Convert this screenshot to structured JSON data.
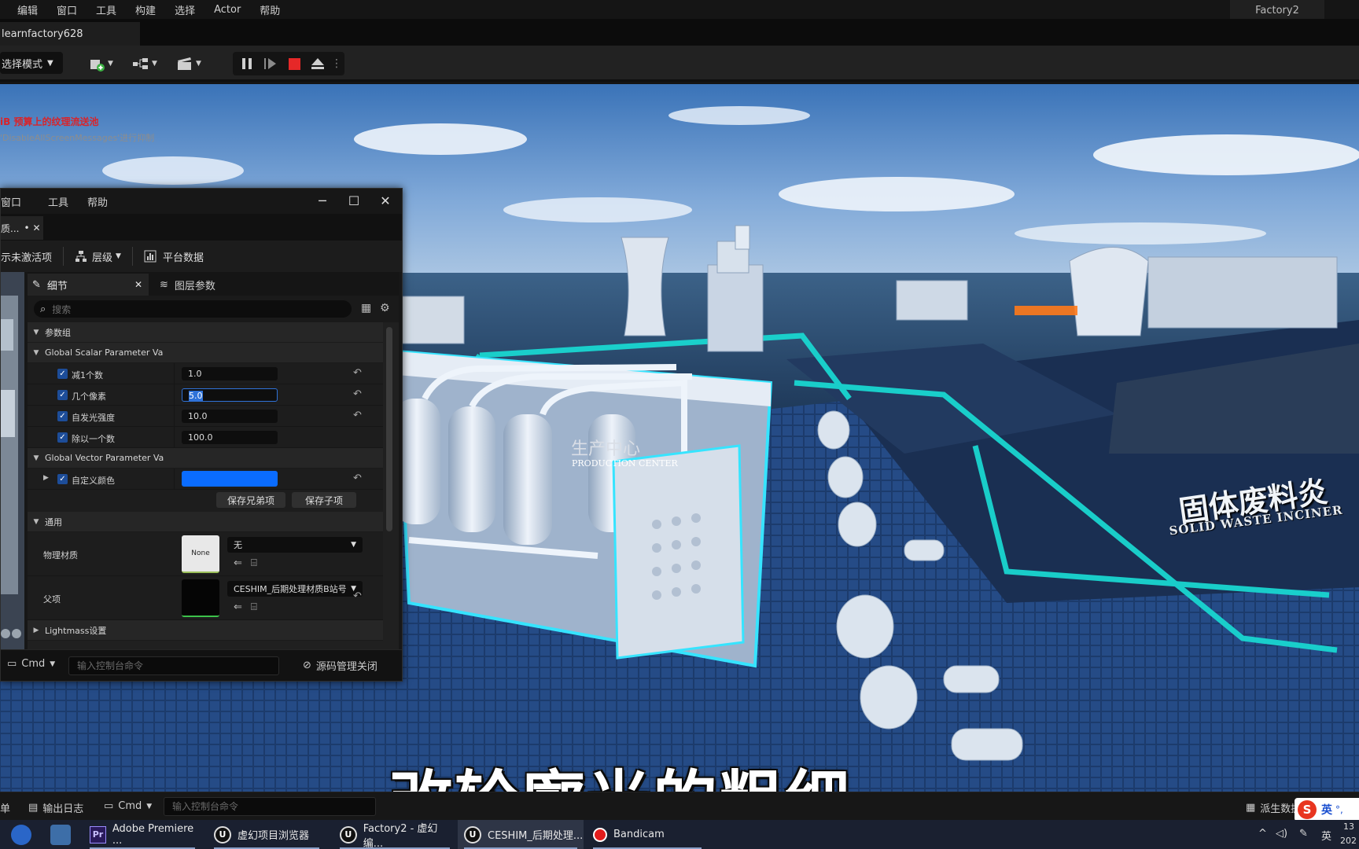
{
  "menu": {
    "items": [
      "编辑",
      "窗口",
      "工具",
      "构建",
      "选择",
      "Actor",
      "帮助"
    ],
    "project_title": "Factory2"
  },
  "level_tab": {
    "label": "learnfactory628"
  },
  "toolbar": {
    "mode_label": "选择模式"
  },
  "viewport": {
    "warning_red": "iB 预算上的纹理流送池",
    "warning_gray": "'DisableAllScreenMessages'进行抑制",
    "sign_solid_waste_zh": "固体废料炎",
    "sign_solid_waste_en": "SOLID WASTE INCINER",
    "sign_production_zh": "生产中心",
    "sign_production_en": "PRODUCTION CENTER",
    "subtitle": "改轮廓光的粗细"
  },
  "panel": {
    "menu": [
      "窗口",
      "工具",
      "帮助"
    ],
    "doc_tab": "质...",
    "toolbar": {
      "inactive_label": "示未激活项",
      "hierarchy_label": "层级",
      "platform_label": "平台数据"
    },
    "details_tab": "细节",
    "layer_tab": "图层参数",
    "search_placeholder": "搜索",
    "categories": {
      "param_group": "参数组",
      "scalar": "Global Scalar Parameter Va",
      "vector": "Global Vector Parameter Va",
      "general": "通用",
      "lightmass": "Lightmass设置"
    },
    "scalar_params": [
      {
        "label": "减1个数",
        "value": "1.0"
      },
      {
        "label": "几个像素",
        "value": "5.0"
      },
      {
        "label": "自发光强度",
        "value": "10.0"
      },
      {
        "label": "除以一个数",
        "value": "100.0"
      }
    ],
    "vector_param": {
      "label": "自定义颜色",
      "color": "#0a6cff"
    },
    "buttons": {
      "save_sibling": "保存兄弟项",
      "save_child": "保存子项"
    },
    "phys_material": {
      "label": "物理材质",
      "thumb_text": "None",
      "dropdown": "无"
    },
    "parent": {
      "label": "父项",
      "dropdown": "CESHIM_后期处理材质B站号"
    },
    "bottom": {
      "cmd_label": "Cmd",
      "cmd_placeholder": "输入控制台命令",
      "source_control": "源码管理关闭"
    }
  },
  "statusbar": {
    "left_label": "单",
    "output_log": "输出日志",
    "cmd_label": "Cmd",
    "cmd_placeholder": "输入控制台命令",
    "derived_data": "派生数据"
  },
  "taskbar": {
    "apps": [
      {
        "label": "Adobe Premiere ..."
      },
      {
        "label": "虚幻项目浏览器"
      },
      {
        "label": "Factory2 - 虚幻编..."
      },
      {
        "label": "CESHIM_后期处理..."
      },
      {
        "label": "Bandicam"
      }
    ],
    "tray_lang": "英",
    "clock_partial": "13",
    "date_partial": "202"
  },
  "ime": {
    "lang": "英"
  },
  "colors": {
    "accent_blue": "#2f72d8",
    "stop_red": "#e62828",
    "glow_cyan": "#19d6d0"
  }
}
